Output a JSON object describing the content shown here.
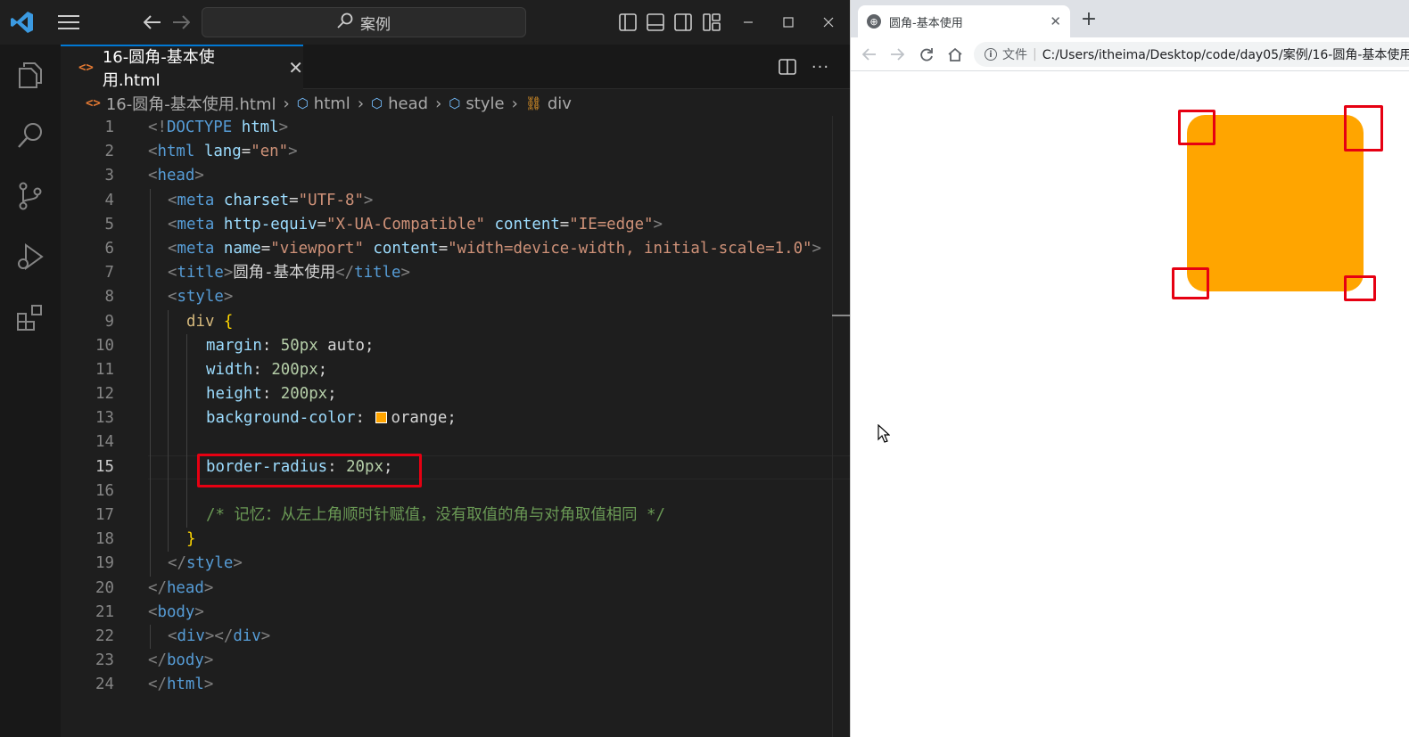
{
  "vscode": {
    "command_center": "案例",
    "tab": {
      "icon": "html-file-icon",
      "filename": "16-圆角-基本使用.html",
      "close": "✕"
    },
    "tab_actions": {
      "more": "···"
    },
    "breadcrumb": {
      "file": "16-圆角-基本使用.html",
      "items": [
        "html",
        "head",
        "style",
        "div"
      ]
    },
    "line_numbers": [
      "1",
      "2",
      "3",
      "4",
      "5",
      "6",
      "7",
      "8",
      "9",
      "10",
      "11",
      "12",
      "13",
      "14",
      "15",
      "16",
      "17",
      "18",
      "19",
      "20",
      "21",
      "22",
      "23",
      "24"
    ],
    "active_line": "15",
    "code": {
      "l1_a": "<!",
      "l1_b": "DOCTYPE",
      "l1_c": " html",
      "l1_d": ">",
      "l2_a": "<",
      "l2_b": "html",
      "l2_c": " lang",
      "l2_d": "=",
      "l2_e": "\"en\"",
      "l2_f": ">",
      "l3_a": "<",
      "l3_b": "head",
      "l3_c": ">",
      "l4_a": "<",
      "l4_b": "meta",
      "l4_c": " charset",
      "l4_d": "=",
      "l4_e": "\"UTF-8\"",
      "l4_f": ">",
      "l5_a": "<",
      "l5_b": "meta",
      "l5_c": " http-equiv",
      "l5_d": "=",
      "l5_e": "\"X-UA-Compatible\"",
      "l5_f": " content",
      "l5_g": "=",
      "l5_h": "\"IE=edge\"",
      "l5_i": ">",
      "l6_a": "<",
      "l6_b": "meta",
      "l6_c": " name",
      "l6_d": "=",
      "l6_e": "\"viewport\"",
      "l6_f": " content",
      "l6_g": "=",
      "l6_h": "\"width=device-width, initial-scale=1.0\"",
      "l6_i": ">",
      "l7_a": "<",
      "l7_b": "title",
      "l7_c": ">",
      "l7_d": "圆角-基本使用",
      "l7_e": "</",
      "l7_f": "title",
      "l7_g": ">",
      "l8_a": "<",
      "l8_b": "style",
      "l8_c": ">",
      "l9_a": "div",
      "l9_b": " {",
      "l10_a": "margin",
      "l10_b": ": ",
      "l10_c": "50px",
      "l10_d": " auto",
      "l10_e": ";",
      "l11_a": "width",
      "l11_b": ": ",
      "l11_c": "200px",
      "l11_d": ";",
      "l12_a": "height",
      "l12_b": ": ",
      "l12_c": "200px",
      "l12_d": ";",
      "l13_a": "background-color",
      "l13_b": ": ",
      "l13_c": "orange",
      "l13_d": ";",
      "l15_a": "border-radius",
      "l15_b": ": ",
      "l15_c": "20px",
      "l15_d": ";",
      "l17_a": "/* 记忆：从左上角顺时针赋值，没有取值的角与对角取值相同 */",
      "l18_a": "}",
      "l19_a": "</",
      "l19_b": "style",
      "l19_c": ">",
      "l20_a": "</",
      "l20_b": "head",
      "l20_c": ">",
      "l21_a": "<",
      "l21_b": "body",
      "l21_c": ">",
      "l22_a": "<",
      "l22_b": "div",
      "l22_c": "></",
      "l22_d": "div",
      "l22_e": ">",
      "l23_a": "</",
      "l23_b": "body",
      "l23_c": ">",
      "l24_a": "</",
      "l24_b": "html",
      "l24_c": ">"
    },
    "colors": {
      "accent": "#0078d4",
      "highlight_box": "#e60012",
      "swatch": "#ffa500"
    }
  },
  "browser": {
    "tab_title": "圆角-基本使用",
    "tab_close": "✕",
    "new_tab": "+",
    "address_label": "文件",
    "address_url": "C:/Users/itheima/Desktop/code/day05/案例/16-圆角-基本使用",
    "page": {
      "box_color": "#ffa500",
      "border_radius": "20px"
    }
  }
}
